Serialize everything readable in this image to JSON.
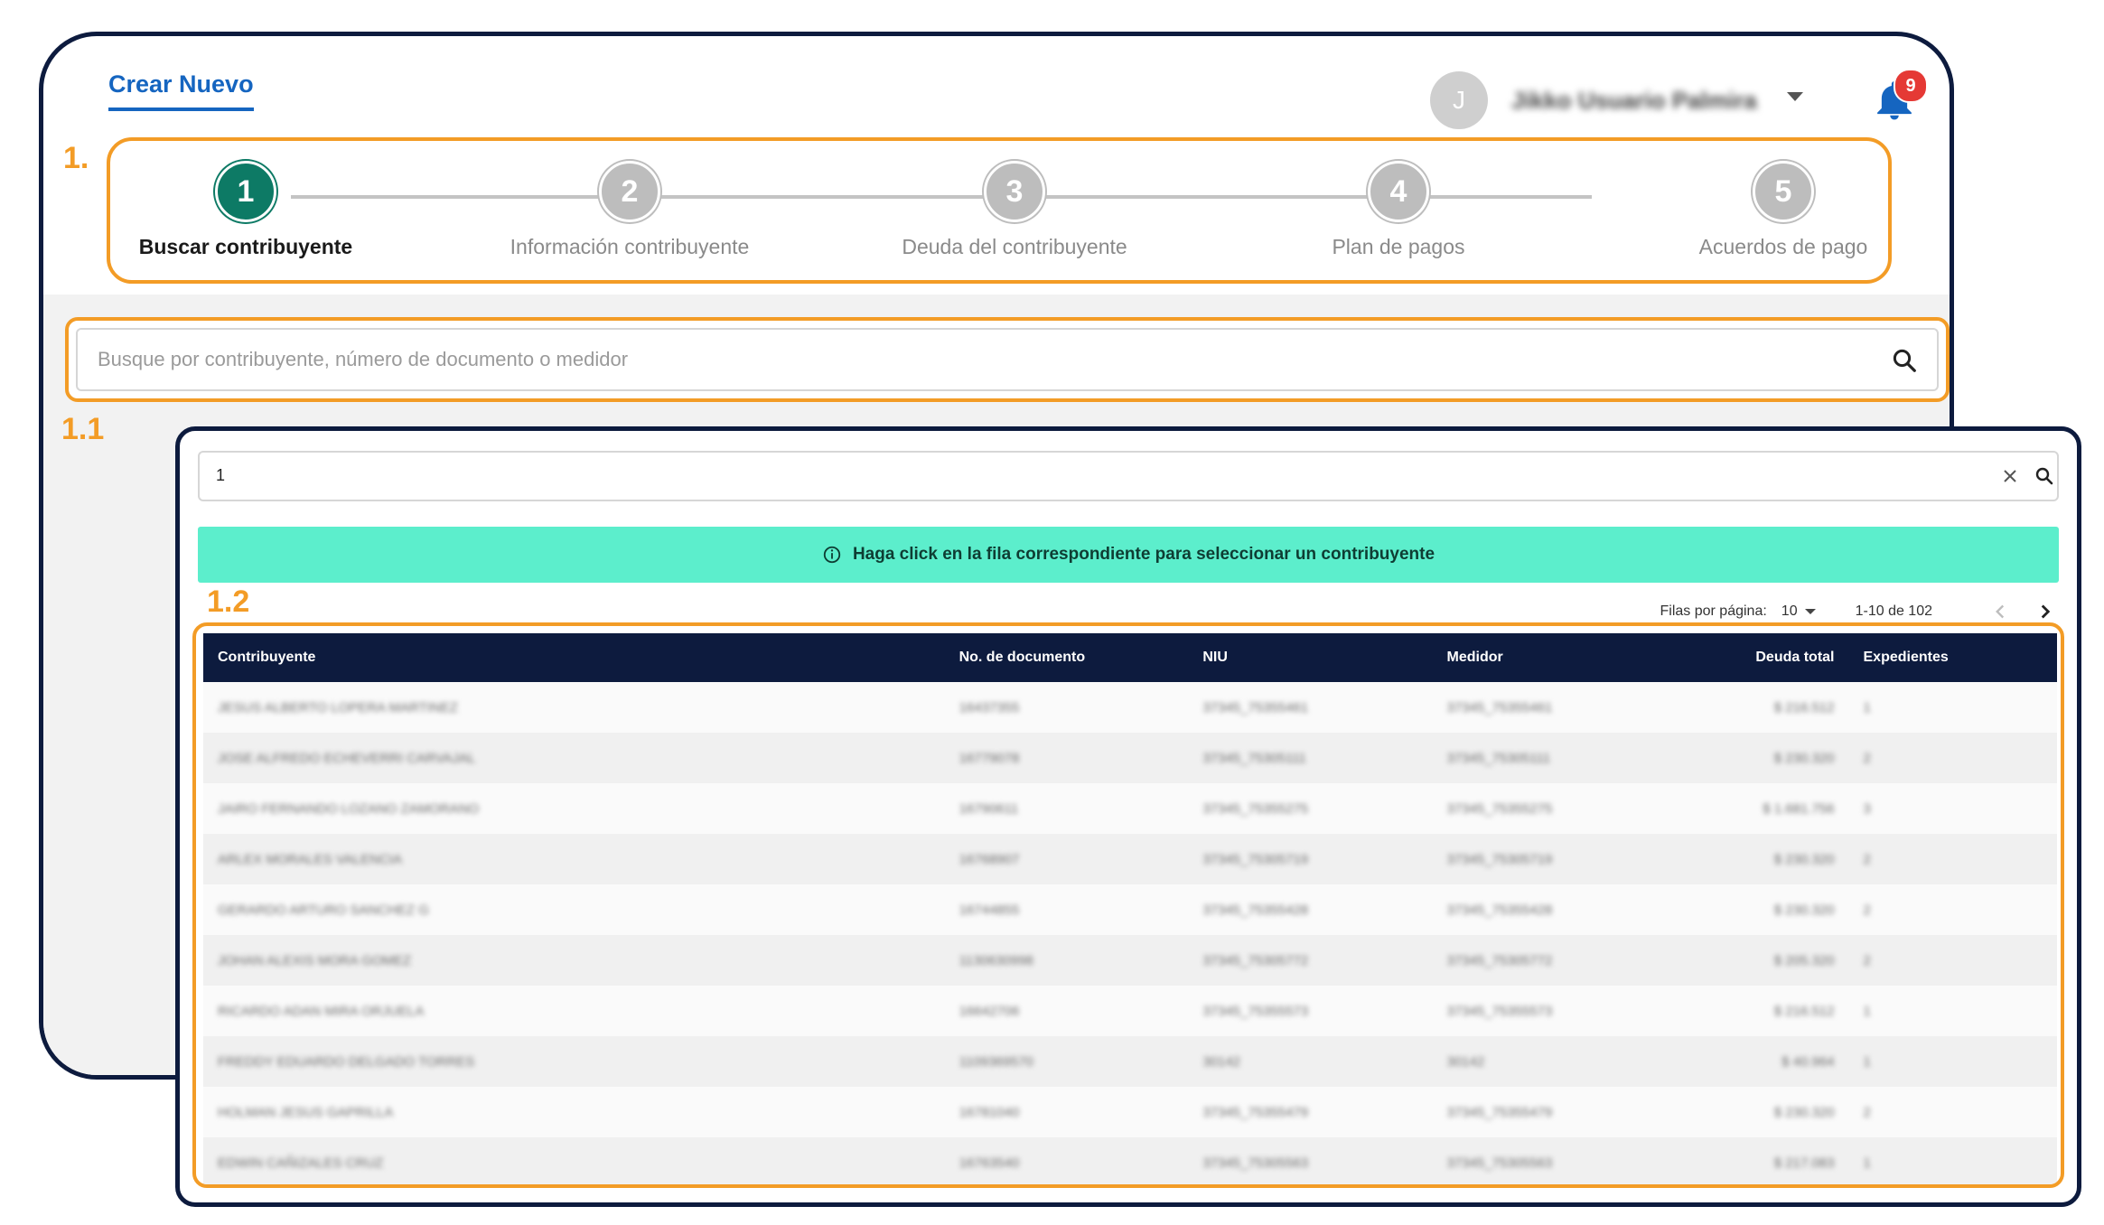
{
  "header": {
    "tab_title": "Crear Nuevo",
    "user": {
      "initial": "J",
      "name": "Jikko Usuario Palmira"
    },
    "notifications": {
      "count": "9"
    }
  },
  "annotations": {
    "stepper": "1.",
    "search": "1.1",
    "table": "1.2"
  },
  "stepper": {
    "steps": [
      {
        "number": "1",
        "label": "Buscar contribuyente"
      },
      {
        "number": "2",
        "label": "Información contribuyente"
      },
      {
        "number": "3",
        "label": "Deuda del contribuyente"
      },
      {
        "number": "4",
        "label": "Plan de pagos"
      },
      {
        "number": "5",
        "label": "Acuerdos de pago"
      }
    ]
  },
  "search": {
    "placeholder": "Busque por contribuyente, número de documento o medidor"
  },
  "results": {
    "query": "1",
    "banner": "Haga click en la fila correspondiente para seleccionar un contribuyente",
    "pagination": {
      "rows_label": "Filas por página:",
      "rows_value": "10",
      "range": "1-10 de 102"
    },
    "columns": [
      "Contribuyente",
      "No. de documento",
      "NIU",
      "Medidor",
      "Deuda total",
      "Expedientes"
    ],
    "rows": [
      {
        "name": "JESUS ALBERTO LOPERA MARTINEZ",
        "doc": "16437355",
        "niu": "37345_75355461",
        "medidor": "37345_75355461",
        "deuda": "$ 216.512",
        "exp": "1"
      },
      {
        "name": "JOSE ALFREDO ECHEVERRI CARVAJAL",
        "doc": "16779078",
        "niu": "37345_75305111",
        "medidor": "37345_75305111",
        "deuda": "$ 230.320",
        "exp": "2"
      },
      {
        "name": "JAIRO FERNANDO LOZANO ZAMORANO",
        "doc": "16790611",
        "niu": "37345_75355275",
        "medidor": "37345_75355275",
        "deuda": "$ 1.681.756",
        "exp": "3"
      },
      {
        "name": "ARLEX MORALES VALENCIA",
        "doc": "16768907",
        "niu": "37345_75305719",
        "medidor": "37345_75305719",
        "deuda": "$ 230.320",
        "exp": "2"
      },
      {
        "name": "GERARDO ARTURO SANCHEZ G",
        "doc": "16744855",
        "niu": "37345_75355428",
        "medidor": "37345_75355428",
        "deuda": "$ 230.320",
        "exp": "2"
      },
      {
        "name": "JOHAN ALEXIS MORA GOMEZ",
        "doc": "1130630998",
        "niu": "37345_75305772",
        "medidor": "37345_75305772",
        "deuda": "$ 205.320",
        "exp": "2"
      },
      {
        "name": "RICARDO ADAN MIRA ORJUELA",
        "doc": "16642706",
        "niu": "37345_75355573",
        "medidor": "37345_75355573",
        "deuda": "$ 216.512",
        "exp": "1"
      },
      {
        "name": "FREDDY EDUARDO DELGADO TORRES",
        "doc": "1109369570",
        "niu": "30142",
        "medidor": "30142",
        "deuda": "$ 40.964",
        "exp": "1"
      },
      {
        "name": "HOLMAN JESUS GAPRILLA",
        "doc": "16781040",
        "niu": "37345_75355479",
        "medidor": "37345_75355479",
        "deuda": "$ 230.320",
        "exp": "2"
      },
      {
        "name": "EDWIN CAÑIZALES CRUZ",
        "doc": "16763540",
        "niu": "37345_75305563",
        "medidor": "37345_75305563",
        "deuda": "$ 217.083",
        "exp": "1"
      }
    ]
  },
  "colors": {
    "accent": "#1565c0",
    "active_step": "#0d7a65",
    "annotation": "#f39c26",
    "table_header": "#0d1b3e",
    "banner": "#5ceecc"
  }
}
